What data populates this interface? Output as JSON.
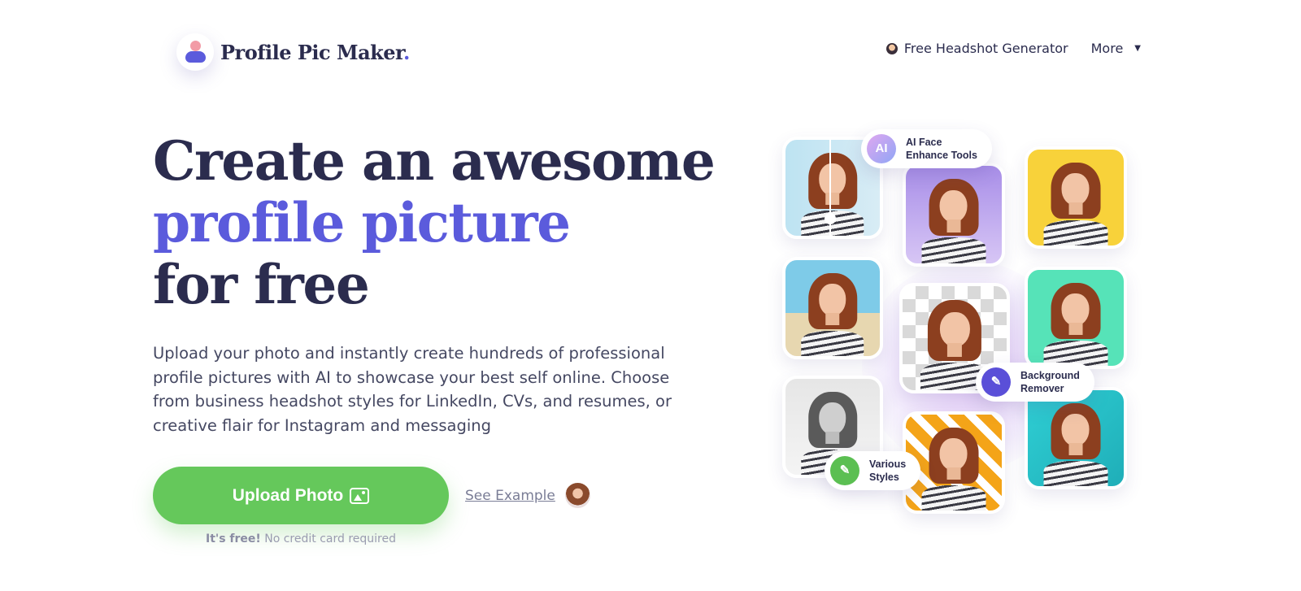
{
  "header": {
    "logo_text": "Profile Pic Maker",
    "logo_dot": ".",
    "nav": {
      "headshot_label": "Free Headshot Generator",
      "more_label": "More",
      "more_caret": "▼"
    }
  },
  "hero": {
    "headline_line1": "Create an awesome",
    "headline_line2": "profile picture",
    "headline_line3": "for free",
    "description": "Upload your photo and instantly create hundreds of professional profile pictures with AI to showcase your best self online. Choose from business headshot styles for LinkedIn, CVs, and resumes, or creative flair for Instagram and messaging",
    "upload_label": "Upload Photo",
    "see_example_label": "See Example",
    "free_bold": "It's free!",
    "free_rest": " No credit card required"
  },
  "collage": {
    "ai_badge": "AI",
    "pill_ai_line1": "AI Face",
    "pill_ai_line2": "Enhance Tools",
    "pill_bg_line1": "Background",
    "pill_bg_line2": "Remover",
    "pill_styles_line1": "Various",
    "pill_styles_line2": "Styles",
    "wand_glyph": "✎",
    "brush_glyph": "✎"
  },
  "colors": {
    "brand": "#5b5bdc",
    "cta": "#65c85b",
    "text": "#2b2c4e"
  },
  "icons": {
    "logo": "user-avatar-icon",
    "headshot_nav": "headshot-icon",
    "upload": "image-icon",
    "background_remover": "magic-wand-icon",
    "various_styles": "paint-brush-icon"
  }
}
